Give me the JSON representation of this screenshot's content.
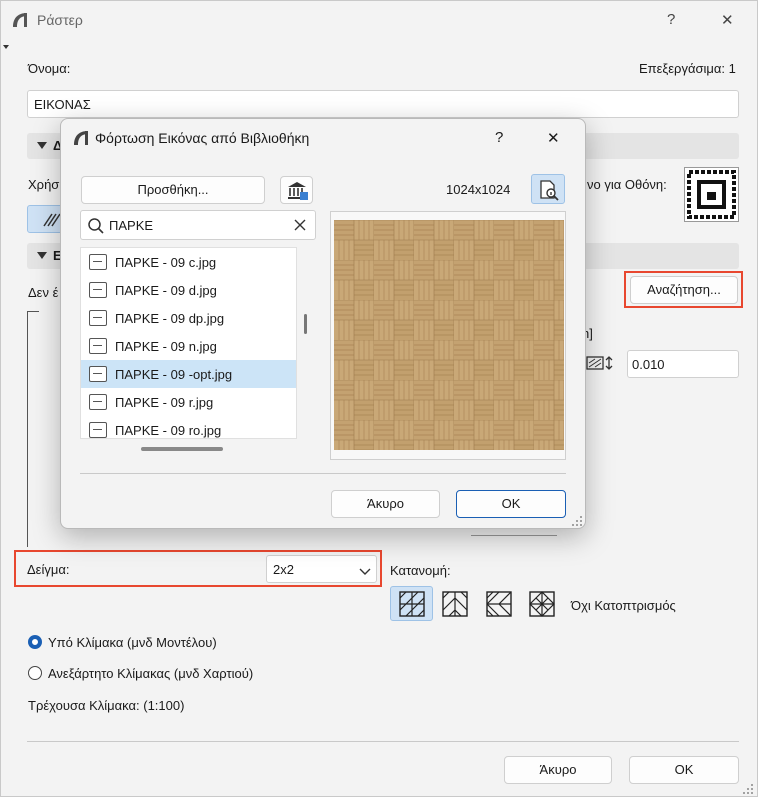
{
  "window": {
    "title": "Ράστερ",
    "help": "?",
    "close": "✕"
  },
  "form": {
    "name_label": "Όνομα:",
    "edit_label": "Επεξεργάσιμα: 1",
    "name_value": "ΕΙΚΟΝΑΣ",
    "section1_title": "Δ",
    "use_label": "Χρήσ",
    "screen_label": "νο για Οθόνη:",
    "section2_title": "Ε",
    "not_found_label": "Δεν έ",
    "search_button": "Αναζήτηση...",
    "unit_label": "h]",
    "scale_value": "0.010",
    "sample_label": "Δείγμα:",
    "sample_value": "2x2",
    "distribution_label": "Κατανομή:",
    "no_mirror_label": "Όχι Κατοπτρισμός",
    "radio_model": "Υπό Κλίμακα (μνδ Μοντέλου)",
    "radio_paper": "Ανεξάρτητο Κλίμακας (μνδ Χαρτιού)",
    "current_scale": "Τρέχουσα Κλίμακα: (1:100)",
    "cancel": "Άκυρο",
    "ok": "OK"
  },
  "dialog": {
    "title": "Φόρτωση Εικόνας από Βιβλιοθήκη",
    "help": "?",
    "close": "✕",
    "add_button": "Προσθήκη...",
    "resolution": "1024x1024",
    "search_value": "ΠΑΡΚΕ",
    "files": [
      "ΠΑΡΚΕ - 09 c.jpg",
      "ΠΑΡΚΕ - 09 d.jpg",
      "ΠΑΡΚΕ - 09 dp.jpg",
      "ΠΑΡΚΕ - 09 n.jpg",
      "ΠΑΡΚΕ - 09 -opt.jpg",
      "ΠΑΡΚΕ - 09 r.jpg",
      "ΠΑΡΚΕ - 09 ro.jpg"
    ],
    "selected_index": 4,
    "cancel": "Άκυρο",
    "ok": "OK"
  },
  "colors": {
    "accent": "#1a5fb4",
    "highlight_red": "#e8472f",
    "selection": "#cce4f7",
    "wood_light": "#c9a877",
    "wood_dark": "#a98453"
  }
}
